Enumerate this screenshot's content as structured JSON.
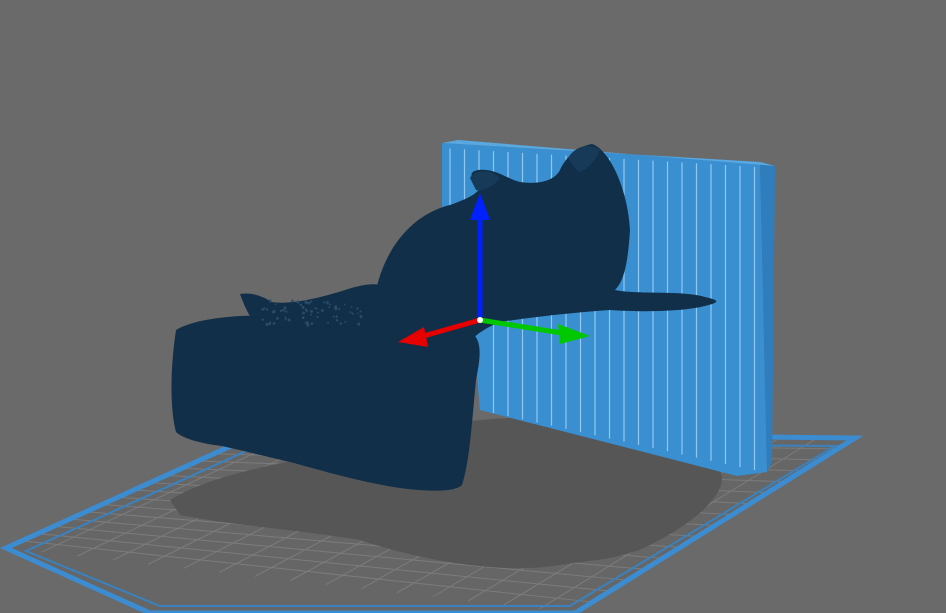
{
  "viewport": {
    "background_color": "#6a6a6a",
    "build_plate": {
      "grid_color": "#7c7c7c",
      "surface_color": "#666666",
      "border_color": "#3c8cd2"
    },
    "model": {
      "color": "#112f48",
      "shadow_color": "#585858"
    },
    "support_wall": {
      "color": "#3a8fd0",
      "stripe_color": "#9fd3f7"
    },
    "gizmo": {
      "x_axis_color": "#e60000",
      "y_axis_color": "#00c800",
      "z_axis_color": "#0020ff",
      "x_axis_icon": "arrow-x-axis-icon",
      "y_axis_icon": "arrow-y-axis-icon",
      "z_axis_icon": "arrow-z-axis-icon"
    }
  }
}
